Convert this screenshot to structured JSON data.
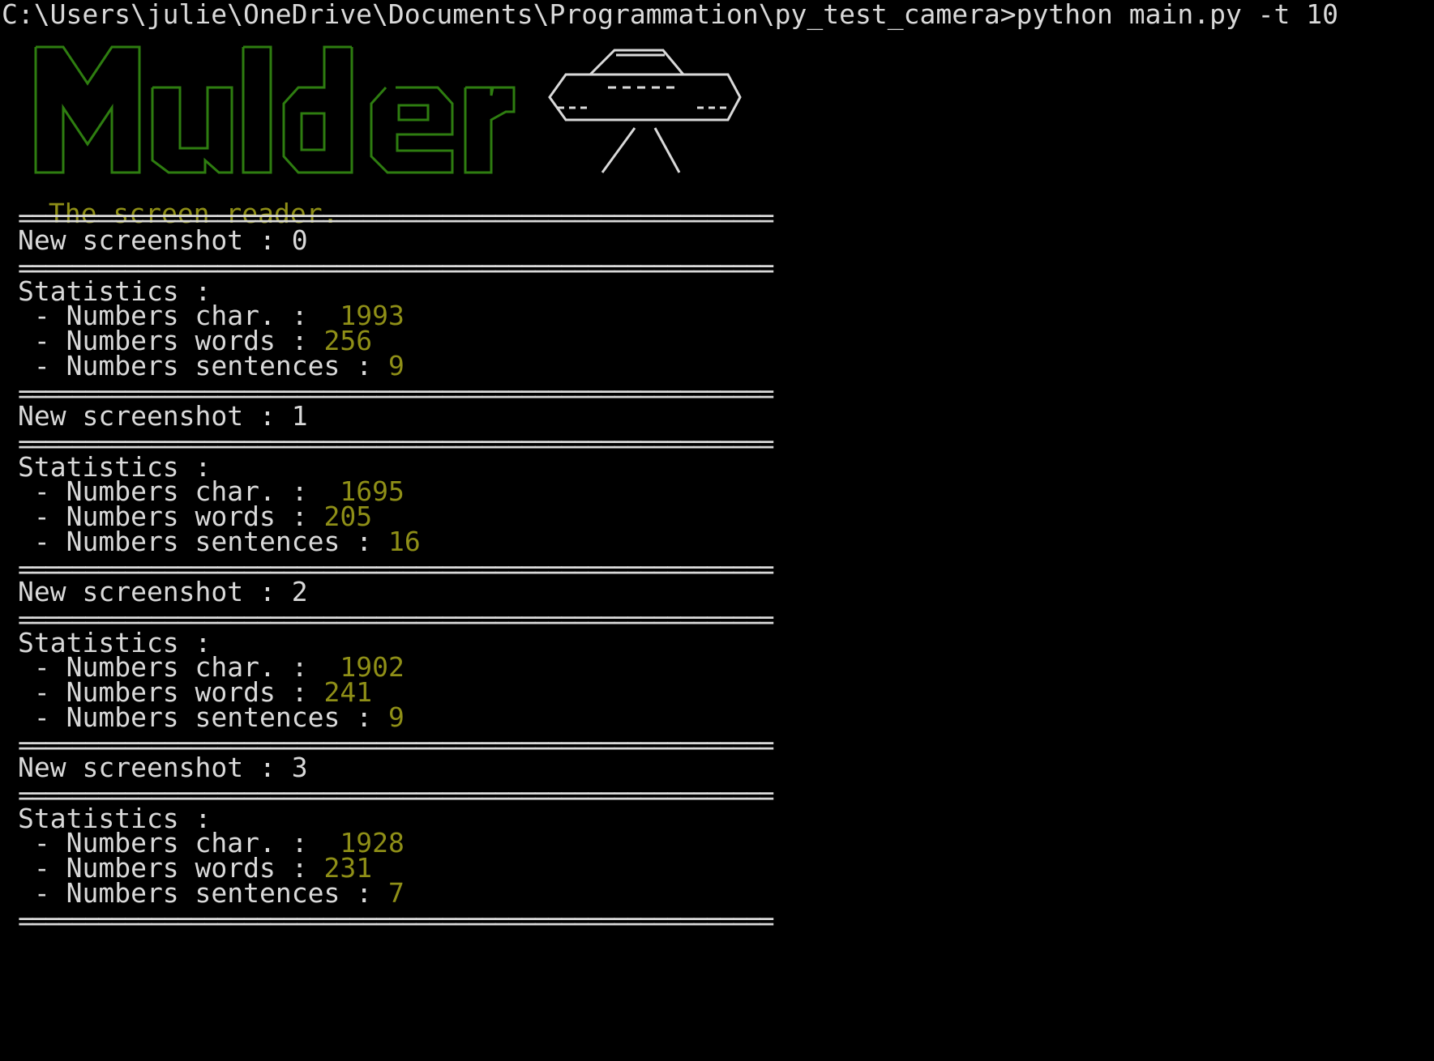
{
  "terminal": {
    "command_line": "C:\\Users\\julie\\OneDrive\\Documents\\Programmation\\py_test_camera>python main.py -t 10",
    "tagline": " The screen reader.",
    "separator": "=========================================================",
    "accent_color": "#8f8f17",
    "banner_color": "#2e7d10",
    "blocks": [
      {
        "header": "New screenshot : 0",
        "stats_title": "Statistics :",
        "chars_label": " - Numbers char. :  ",
        "chars_value": "1993",
        "words_label": " - Numbers words : ",
        "words_value": "256",
        "sentences_label": " - Numbers sentences : ",
        "sentences_value": "9"
      },
      {
        "header": "New screenshot : 1",
        "stats_title": "Statistics :",
        "chars_label": " - Numbers char. :  ",
        "chars_value": "1695",
        "words_label": " - Numbers words : ",
        "words_value": "205",
        "sentences_label": " - Numbers sentences : ",
        "sentences_value": "16"
      },
      {
        "header": "New screenshot : 2",
        "stats_title": "Statistics :",
        "chars_label": " - Numbers char. :  ",
        "chars_value": "1902",
        "words_label": " - Numbers words : ",
        "words_value": "241",
        "sentences_label": " - Numbers sentences : ",
        "sentences_value": "9"
      },
      {
        "header": "New screenshot : 3",
        "stats_title": "Statistics :",
        "chars_label": " - Numbers char. :  ",
        "chars_value": "1928",
        "words_label": " - Numbers words : ",
        "words_value": "231",
        "sentences_label": " - Numbers sentences : ",
        "sentences_value": "7"
      }
    ]
  },
  "banner": {
    "logo_text": "Mulder",
    "icon": "ufo-icon"
  }
}
